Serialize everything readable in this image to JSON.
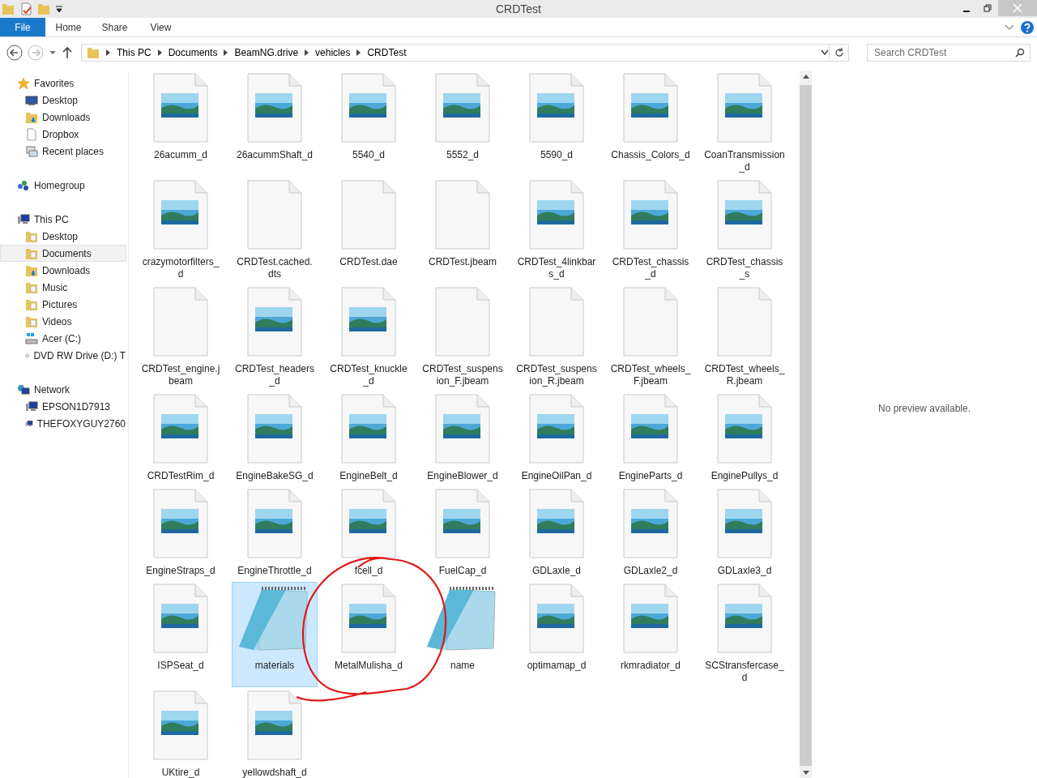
{
  "window": {
    "title": "CRDTest"
  },
  "ribbon": {
    "tabs": [
      {
        "label": "File",
        "selected": true
      },
      {
        "label": "Home",
        "selected": false
      },
      {
        "label": "Share",
        "selected": false
      },
      {
        "label": "View",
        "selected": false
      }
    ]
  },
  "address": {
    "crumbs": [
      "This PC",
      "Documents",
      "BeamNG.drive",
      "vehicles",
      "CRDTest"
    ]
  },
  "search": {
    "placeholder": "Search CRDTest"
  },
  "sidebar": {
    "groups": [
      {
        "label": "Favorites",
        "kind": "star",
        "children": [
          {
            "label": "Desktop",
            "kind": "monitor",
            "selected": false
          },
          {
            "label": "Downloads",
            "kind": "download",
            "selected": false
          },
          {
            "label": "Dropbox",
            "kind": "page",
            "selected": false
          },
          {
            "label": "Recent places",
            "kind": "recent",
            "selected": false
          }
        ]
      },
      {
        "label": "Homegroup",
        "kind": "homegroup"
      },
      {
        "label": "This PC",
        "kind": "pc",
        "children": [
          {
            "label": "Desktop",
            "kind": "folder",
            "selected": false
          },
          {
            "label": "Documents",
            "kind": "folder",
            "selected": true
          },
          {
            "label": "Downloads",
            "kind": "download",
            "selected": false
          },
          {
            "label": "Music",
            "kind": "folder",
            "selected": false
          },
          {
            "label": "Pictures",
            "kind": "folder",
            "selected": false
          },
          {
            "label": "Videos",
            "kind": "folder",
            "selected": false
          },
          {
            "label": "Acer (C:)",
            "kind": "drive",
            "selected": false
          },
          {
            "label": "DVD RW Drive (D:) T",
            "kind": "dvd",
            "selected": false
          }
        ]
      },
      {
        "label": "Network",
        "kind": "network",
        "children": [
          {
            "label": "EPSON1D7913",
            "kind": "pc",
            "selected": false
          },
          {
            "label": "THEFOXYGUY2760",
            "kind": "pc",
            "selected": false
          }
        ]
      }
    ]
  },
  "files": [
    {
      "name": "26acumm_d",
      "kind": "image",
      "selected": false
    },
    {
      "name": "26acummShaft_d",
      "kind": "image",
      "selected": false
    },
    {
      "name": "5540_d",
      "kind": "image",
      "selected": false
    },
    {
      "name": "5552_d",
      "kind": "image",
      "selected": false
    },
    {
      "name": "5590_d",
      "kind": "image",
      "selected": false
    },
    {
      "name": "Chassis_Colors_d",
      "kind": "image",
      "selected": false
    },
    {
      "name": "CoanTransmission_d",
      "kind": "image",
      "selected": false
    },
    {
      "name": "crazymotorfilters_d",
      "kind": "image",
      "selected": false
    },
    {
      "name": "CRDTest.cached.dts",
      "kind": "blank",
      "selected": false
    },
    {
      "name": "CRDTest.dae",
      "kind": "blank",
      "selected": false
    },
    {
      "name": "CRDTest.jbeam",
      "kind": "blank",
      "selected": false
    },
    {
      "name": "CRDTest_4linkbars_d",
      "kind": "image",
      "selected": false
    },
    {
      "name": "CRDTest_chassis_d",
      "kind": "image",
      "selected": false
    },
    {
      "name": "CRDTest_chassis_s",
      "kind": "image",
      "selected": false
    },
    {
      "name": "CRDTest_engine.jbeam",
      "kind": "blank",
      "selected": false
    },
    {
      "name": "CRDTest_headers_d",
      "kind": "image",
      "selected": false
    },
    {
      "name": "CRDTest_knuckle_d",
      "kind": "image",
      "selected": false
    },
    {
      "name": "CRDTest_suspension_F.jbeam",
      "kind": "blank",
      "selected": false
    },
    {
      "name": "CRDTest_suspension_R.jbeam",
      "kind": "blank",
      "selected": false
    },
    {
      "name": "CRDTest_wheels_F.jbeam",
      "kind": "blank",
      "selected": false
    },
    {
      "name": "CRDTest_wheels_R.jbeam",
      "kind": "blank",
      "selected": false
    },
    {
      "name": "CRDTestRim_d",
      "kind": "image",
      "selected": false
    },
    {
      "name": "EngineBakeSG_d",
      "kind": "image",
      "selected": false
    },
    {
      "name": "EngineBelt_d",
      "kind": "image",
      "selected": false
    },
    {
      "name": "EngineBlower_d",
      "kind": "image",
      "selected": false
    },
    {
      "name": "EngineOilPan_d",
      "kind": "image",
      "selected": false
    },
    {
      "name": "EngineParts_d",
      "kind": "image",
      "selected": false
    },
    {
      "name": "EnginePullys_d",
      "kind": "image",
      "selected": false
    },
    {
      "name": "EngineStraps_d",
      "kind": "image",
      "selected": false
    },
    {
      "name": "EngineThrottle_d",
      "kind": "image",
      "selected": false
    },
    {
      "name": "fcell_d",
      "kind": "image",
      "selected": false
    },
    {
      "name": "FuelCap_d",
      "kind": "image",
      "selected": false
    },
    {
      "name": "GDLaxle_d",
      "kind": "image",
      "selected": false
    },
    {
      "name": "GDLaxle2_d",
      "kind": "image",
      "selected": false
    },
    {
      "name": "GDLaxle3_d",
      "kind": "image",
      "selected": false
    },
    {
      "name": "ISPSeat_d",
      "kind": "image",
      "selected": false
    },
    {
      "name": "materials",
      "kind": "notepad",
      "selected": true
    },
    {
      "name": "MetalMulisha_d",
      "kind": "image",
      "selected": false
    },
    {
      "name": "name",
      "kind": "notepad",
      "selected": false
    },
    {
      "name": "optimamap_d",
      "kind": "image",
      "selected": false
    },
    {
      "name": "rkmradiator_d",
      "kind": "image",
      "selected": false
    },
    {
      "name": "SCStransfercase_d",
      "kind": "image",
      "selected": false
    },
    {
      "name": "UKtire_d",
      "kind": "image",
      "selected": false
    },
    {
      "name": "yellowdshaft_d",
      "kind": "image",
      "selected": false
    }
  ],
  "preview": {
    "message": "No preview available."
  }
}
